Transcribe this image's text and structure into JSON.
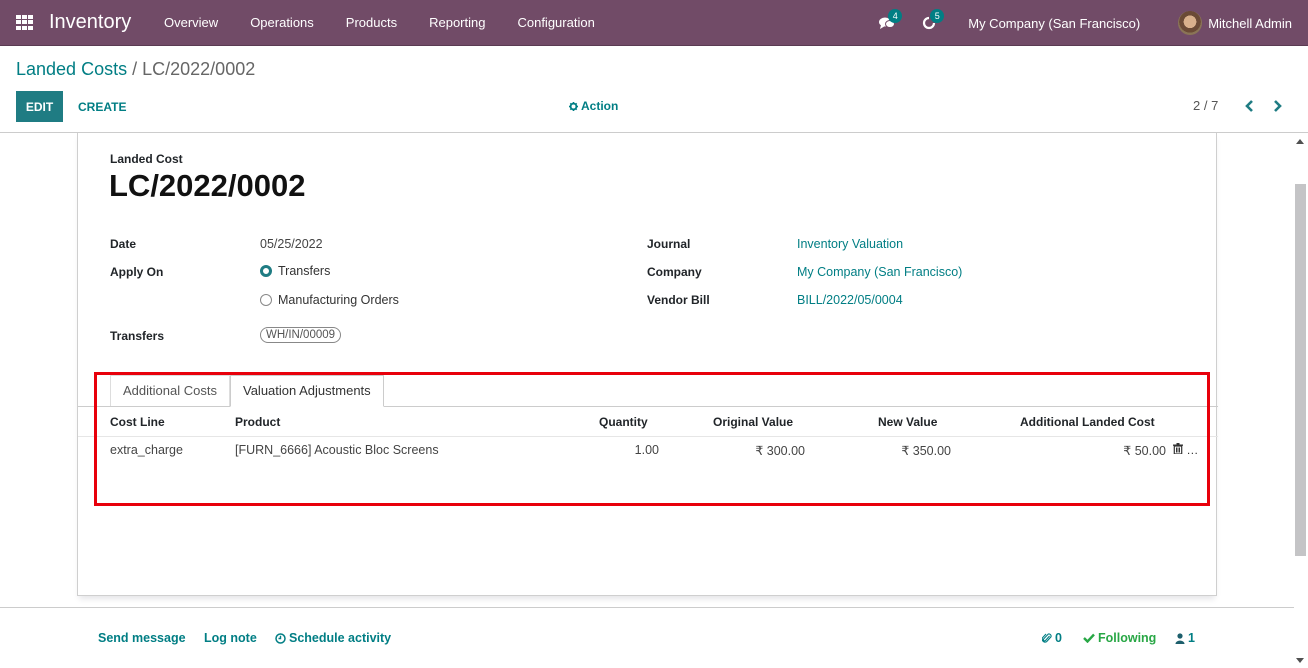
{
  "navbar": {
    "app_name": "Inventory",
    "menu": [
      "Overview",
      "Operations",
      "Products",
      "Reporting",
      "Configuration"
    ],
    "messages_count": "4",
    "activities_count": "5",
    "company": "My Company (San Francisco)",
    "user": "Mitchell Admin",
    "brand_color": "#714B67"
  },
  "control_panel": {
    "breadcrumb_parent": "Landed Costs",
    "breadcrumb_separator": "/",
    "breadcrumb_current": "LC/2022/0002",
    "edit_label": "EDIT",
    "create_label": "CREATE",
    "action_label": "Action",
    "pager": "2 / 7"
  },
  "form": {
    "record_label": "Landed Cost",
    "record_name": "LC/2022/0002",
    "fields": {
      "date_label": "Date",
      "date_value": "05/25/2022",
      "apply_on_label": "Apply On",
      "apply_on_options": [
        "Transfers",
        "Manufacturing Orders"
      ],
      "apply_on_selected": "Transfers",
      "transfers_label": "Transfers",
      "transfers_tags": [
        "WH/IN/00009"
      ],
      "journal_label": "Journal",
      "journal_value": "Inventory Valuation",
      "company_label": "Company",
      "company_value": "My Company (San Francisco)",
      "vendor_bill_label": "Vendor Bill",
      "vendor_bill_value": "BILL/2022/05/0004"
    },
    "tabs": [
      "Additional Costs",
      "Valuation Adjustments"
    ],
    "active_tab": "Valuation Adjustments",
    "table": {
      "columns": [
        "Cost Line",
        "Product",
        "Quantity",
        "Original Value",
        "New Value",
        "Additional Landed Cost"
      ],
      "rows": [
        {
          "cost_line": "extra_charge",
          "product": "[FURN_6666] Acoustic Bloc Screens",
          "quantity": "1.00",
          "original_value": "₹ 300.00",
          "new_value": "₹ 350.00",
          "additional_landed_cost": "₹ 50.00"
        }
      ]
    }
  },
  "chatter": {
    "send_message": "Send message",
    "log_note": "Log note",
    "schedule_activity": "Schedule activity",
    "attachments_count": "0",
    "following_label": "Following",
    "followers_count": "1"
  },
  "annotation": {
    "highlight_color": "#e8000b"
  }
}
